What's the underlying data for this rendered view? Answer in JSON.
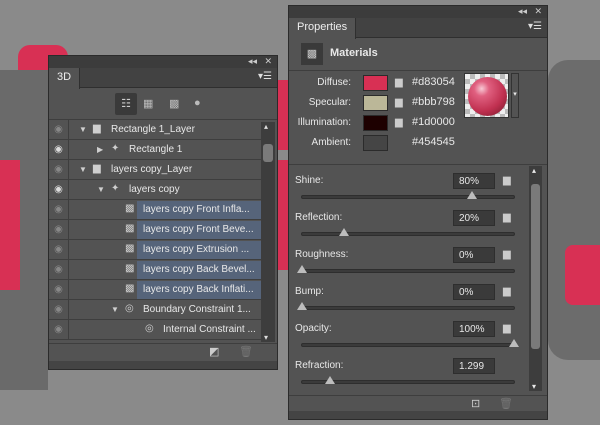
{
  "panel3d": {
    "tab": "3D",
    "filter_icons": [
      "scene-icon",
      "mesh-icon",
      "materials-icon",
      "light-icon"
    ],
    "rows": [
      {
        "label": "Rectangle 1_Layer",
        "eye": false,
        "indent": 0,
        "toggle": "▼",
        "icon": "folder-icon",
        "selected": false
      },
      {
        "label": "Rectangle 1",
        "eye": true,
        "indent": 1,
        "toggle": "▶",
        "icon": "mesh-icon",
        "selected": false
      },
      {
        "label": "layers copy_Layer",
        "eye": false,
        "indent": 0,
        "toggle": "▼",
        "icon": "folder-icon",
        "selected": false
      },
      {
        "label": "layers copy",
        "eye": true,
        "indent": 1,
        "toggle": "▼",
        "icon": "mesh-icon",
        "selected": false
      },
      {
        "label": "layers copy Front Infla...",
        "eye": false,
        "indent": 2,
        "toggle": "",
        "icon": "material-icon",
        "selected": true
      },
      {
        "label": "layers copy Front Beve...",
        "eye": false,
        "indent": 2,
        "toggle": "",
        "icon": "material-icon",
        "selected": true
      },
      {
        "label": "layers copy Extrusion ...",
        "eye": false,
        "indent": 2,
        "toggle": "",
        "icon": "material-icon",
        "selected": true
      },
      {
        "label": "layers copy Back Bevel...",
        "eye": false,
        "indent": 2,
        "toggle": "",
        "icon": "material-icon",
        "selected": true
      },
      {
        "label": "layers copy Back Inflati...",
        "eye": false,
        "indent": 2,
        "toggle": "",
        "icon": "material-icon",
        "selected": true
      },
      {
        "label": "Boundary Constraint 1...",
        "eye": false,
        "indent": 2,
        "toggle": "▼",
        "icon": "constraint-icon",
        "selected": false
      },
      {
        "label": "Internal Constraint ...",
        "eye": false,
        "indent": 3,
        "toggle": "",
        "icon": "constraint-icon",
        "selected": false
      }
    ]
  },
  "properties": {
    "tab": "Properties",
    "section": "Materials",
    "colors": [
      {
        "label": "Diffuse:",
        "hex": "#d83054",
        "color": "#d83054",
        "folder": true
      },
      {
        "label": "Specular:",
        "hex": "#bbb798",
        "color": "#bbb798",
        "folder": true
      },
      {
        "label": "Illumination:",
        "hex": "#1d0000",
        "color": "#1d0000",
        "folder": true
      },
      {
        "label": "Ambient:",
        "hex": "#454545",
        "color": "#454545",
        "folder": false
      }
    ],
    "sliders": [
      {
        "label": "Shine:",
        "value": "80%",
        "fraction": 0.8,
        "folder": true
      },
      {
        "label": "Reflection:",
        "value": "20%",
        "fraction": 0.2,
        "folder": true
      },
      {
        "label": "Roughness:",
        "value": "0%",
        "fraction": 0,
        "folder": true
      },
      {
        "label": "Bump:",
        "value": "0%",
        "fraction": 0,
        "folder": true
      },
      {
        "label": "Opacity:",
        "value": "100%",
        "fraction": 1,
        "folder": true
      },
      {
        "label": "Refraction:",
        "value": "1.299",
        "fraction": 0.13,
        "folder": false
      }
    ]
  }
}
